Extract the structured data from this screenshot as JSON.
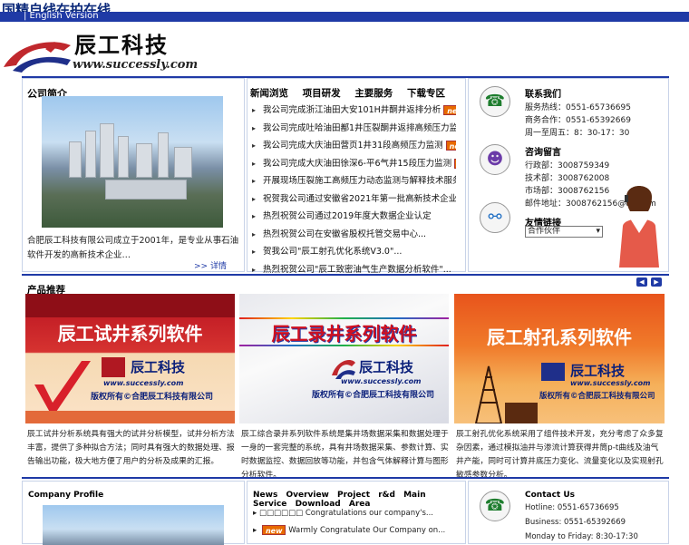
{
  "header": {
    "site_title": "国精自线在拍在线",
    "lang_link": "| English Version"
  },
  "logo": {
    "cn_name": "辰工科技",
    "url": "www.successly.com"
  },
  "company": {
    "title": "公司简介",
    "intro": "合肥辰工科技有限公司成立于2001年，是专业从事石油软件开发的高新技术企业…",
    "more": ">> 详情"
  },
  "news": {
    "tabs": [
      "新闻浏览",
      "项目研发",
      "主要服务",
      "下载专区"
    ],
    "items": [
      {
        "text": "我公司完成浙江油田大安101H井酮井返排分析",
        "new": true
      },
      {
        "text": "我公司完成吐哈油田鄯1井压裂酮井返排高频压力监测",
        "new": true
      },
      {
        "text": "我公司完成大庆油田营页1井31段高频压力监测",
        "new": true
      },
      {
        "text": "我公司完成大庆油田徐深6-平6气井15段压力监测",
        "new": true
      },
      {
        "text": "开展现场压裂施工高频压力动态监测与解释技术服务",
        "new": false
      },
      {
        "text": "祝贺我公司通过安徽省2021年第一批高新技术企业认定",
        "new": false
      },
      {
        "text": "热烈祝贺公司通过2019年度大数据企业认定",
        "new": false
      },
      {
        "text": "热烈祝贺公司在安徽省股权托管交易中心...",
        "new": false
      },
      {
        "text": "贺我公司\"辰工射孔优化系统V3.0\"...",
        "new": false
      },
      {
        "text": "热烈祝贺公司\"辰工致密油气生产数据分析软件\"...",
        "new": false
      }
    ],
    "badge": "new"
  },
  "contact": {
    "title": "联系我们",
    "hotline": "服务热线：0551-65736695",
    "business": "商务合作：0551-65392669",
    "hours": "周一至周五：8：30-17：30",
    "msg_title": "咨询留言",
    "admin": "行政部：3008759349",
    "tech": "技术部：3008762008",
    "market": "市场部：3008762156",
    "email": "邮件地址：3008762156@qq.com",
    "links_title": "友情链接",
    "select_value": "合作伙伴"
  },
  "products": {
    "title": "产品推荐",
    "items": [
      {
        "name": "辰工试井系列软件",
        "brand": "辰工科技",
        "url": "www.successly.com",
        "copy": "版权所有©合肥辰工科技有限公司",
        "desc": "辰工试井分析系统具有强大的试井分析模型，试井分析方法丰富，提供了多种拟合方法；同时具有强大的数据处理、报告输出功能，极大地方便了用户的分析及成果的汇报。"
      },
      {
        "name": "辰工录井系列软件",
        "brand": "辰工科技",
        "url": "www.successly.com",
        "copy": "版权所有©合肥辰工科技有限公司",
        "desc": "辰工综合录井系列软件系统是集井场数据采集和数据处理于一身的一套完整的系统，具有井场数据采集、参数计算、实时数据监控、数据回放等功能，并包含气体解释计算与图形分析软件。"
      },
      {
        "name": "辰工射孔系列软件",
        "brand": "辰工科技",
        "url": "www.successly.com",
        "copy": "版权所有©合肥辰工科技有限公司",
        "desc": "辰工射孔优化系统采用了组件技术开发，充分考虑了众多复杂因素，通过模拟油井与渗流计算获得井筒p-t曲线及油气井产能，同时可计算井底压力变化、流量变化以及实现射孔敏感参数分析。"
      }
    ]
  },
  "english": {
    "company_title": "Company Profile",
    "tabs": [
      "News Overview",
      "Project r&d",
      "Main Service",
      "Download Area"
    ],
    "items": [
      "Congratulations our company's...",
      "Warmly Congratulate Our Company on..."
    ],
    "contact_title": "Contact Us",
    "hotline": "Hotline: 0551-65736695",
    "business": "Business: 0551-65392669",
    "hours": "Monday to Friday: 8:30-17:30"
  },
  "colors": {
    "accent": "#1f3aa6",
    "badge": "#e86a00"
  }
}
